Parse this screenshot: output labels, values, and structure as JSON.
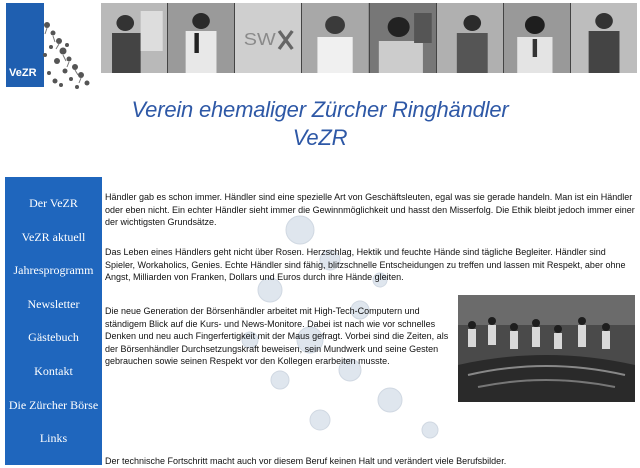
{
  "logo": {
    "text": "VeZR"
  },
  "banner": {
    "photos": [
      "trader-photo",
      "trader-photo",
      "swx-sign-photo",
      "trader-photo",
      "trader-photo",
      "trader-photo",
      "trader-photo",
      "trader-photo"
    ]
  },
  "title": {
    "line1": "Verein ehemaliger Zürcher Ringhändler",
    "line2": "VeZR"
  },
  "nav": {
    "items": [
      {
        "label": "Der VeZR"
      },
      {
        "label": "VeZR aktuell"
      },
      {
        "label": "Jahresprogramm"
      },
      {
        "label": "Newsletter"
      },
      {
        "label": "Gästebuch"
      },
      {
        "label": "Kontakt"
      },
      {
        "label": "Die Zürcher Börse"
      },
      {
        "label": "Links"
      }
    ]
  },
  "content": {
    "paragraphs": [
      "Händler gab es schon immer. Händler sind eine spezielle Art von Geschäftsleuten, egal was sie gerade handeln. Man ist ein Händler oder eben nicht. Ein echter Händler sieht immer die Gewinnmöglichkeit und hasst den Misserfolg. Die Ethik bleibt jedoch immer einer der wichtigsten Grundsätze.",
      "Das Leben eines Händlers geht nicht über Rosen. Herzschlag, Hektik und feuchte Hände sind tägliche Begleiter. Händler sind Spieler, Workaholics, Genies. Echte Händler sind fähig, blitzschnelle Entscheidungen zu treffen und lassen mit Respekt, aber ohne Angst, Milliarden von Franken, Dollars und Euros durch ihre Hände gleiten.",
      "Die neue Generation der Börsenhändler arbeitet mit High-Tech-Computern und ständigem Blick auf die Kurs- und News-Monitore. Dabei ist nach wie vor schnelles Denken und neu auch Fingerfertigkeit mit der Maus gefragt. Vorbei sind die Zeiten, als der Börsenhändler Durchsetzungskraft beweisen, sein Mundwerk und seine Gesten gebrauchen sowie seinen Respekt vor den Kollegen erarbeiten musste.",
      "Der technische Fortschritt macht auch vor diesem Beruf keinen Halt und verändert viele Berufsbilder."
    ]
  },
  "colors": {
    "nav_bg": "#1f66bd",
    "title": "#2e58a6",
    "logo_bg": "#1f5fb0"
  }
}
